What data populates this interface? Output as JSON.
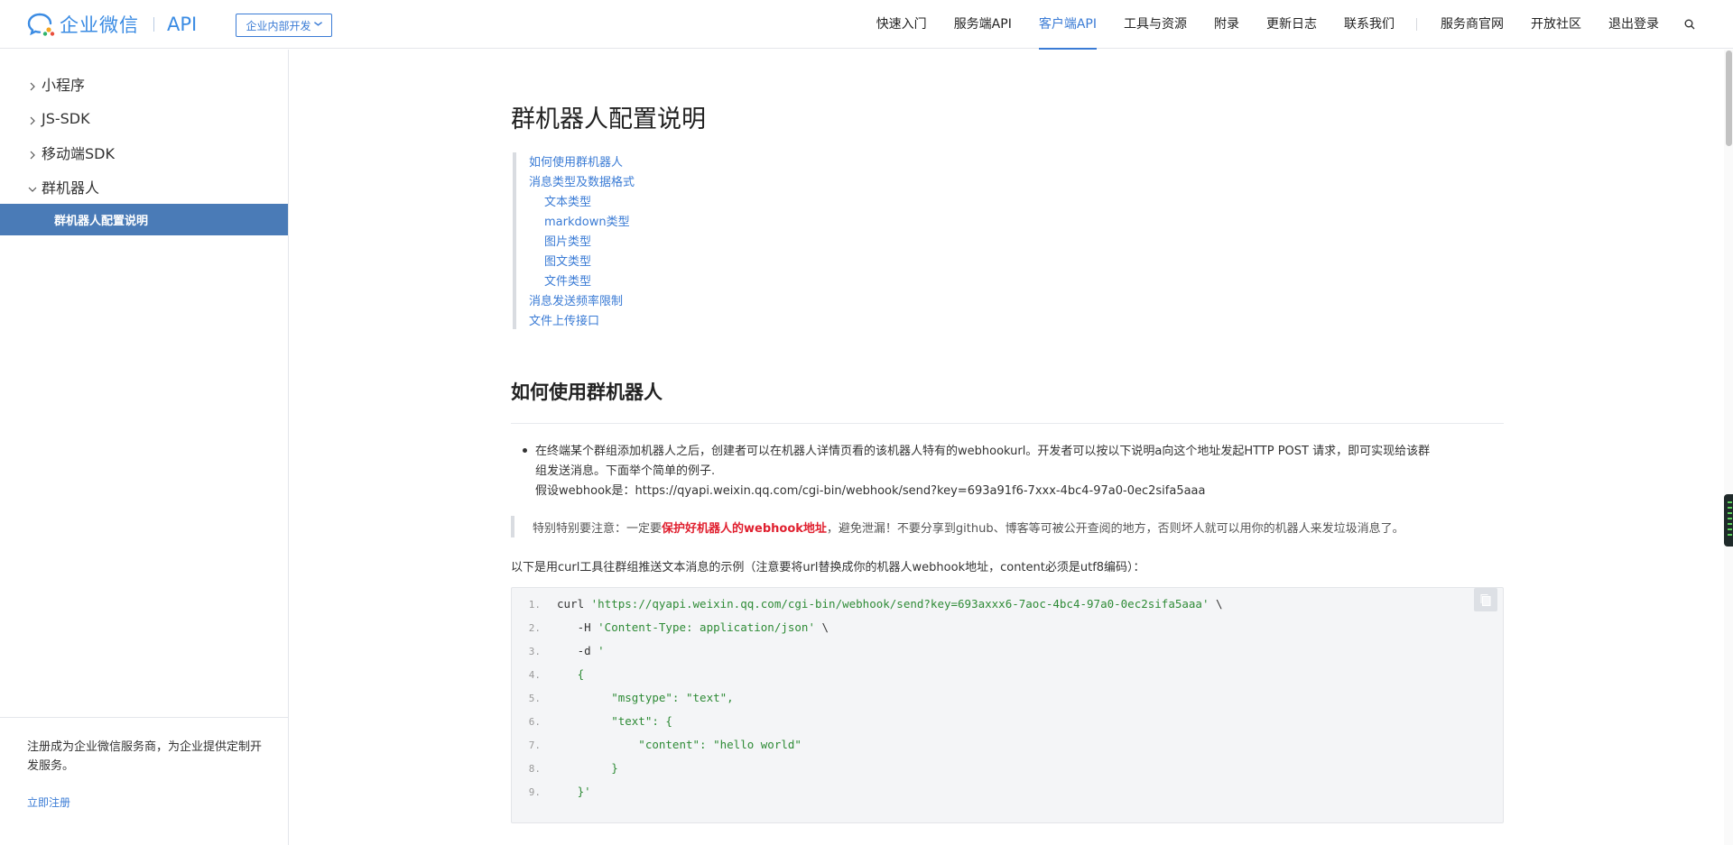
{
  "header": {
    "logo_text": "企业微信",
    "logo_api": "API",
    "dev_select": "企业内部开发",
    "nav": [
      {
        "label": "快速入门",
        "active": false
      },
      {
        "label": "服务端API",
        "active": false
      },
      {
        "label": "客户端API",
        "active": true
      },
      {
        "label": "工具与资源",
        "active": false
      },
      {
        "label": "附录",
        "active": false
      },
      {
        "label": "更新日志",
        "active": false
      },
      {
        "label": "联系我们",
        "active": false
      },
      {
        "label": "服务商官网",
        "active": false
      },
      {
        "label": "开放社区",
        "active": false
      },
      {
        "label": "退出登录",
        "active": false
      }
    ]
  },
  "sidebar": {
    "items": [
      {
        "label": "小程序",
        "expanded": false
      },
      {
        "label": "JS-SDK",
        "expanded": false
      },
      {
        "label": "移动端SDK",
        "expanded": false
      },
      {
        "label": "群机器人",
        "expanded": true
      }
    ],
    "active_sub": "群机器人配置说明",
    "footer_text": "注册成为企业微信服务商，为企业提供定制开发服务。",
    "register_link": "立即注册"
  },
  "content": {
    "title": "群机器人配置说明",
    "toc": [
      {
        "label": "如何使用群机器人",
        "level": 0
      },
      {
        "label": "消息类型及数据格式",
        "level": 0
      },
      {
        "label": "文本类型",
        "level": 1
      },
      {
        "label": "markdown类型",
        "level": 1
      },
      {
        "label": "图片类型",
        "level": 1
      },
      {
        "label": "图文类型",
        "level": 1
      },
      {
        "label": "文件类型",
        "level": 1
      },
      {
        "label": "消息发送频率限制",
        "level": 0
      },
      {
        "label": "文件上传接口",
        "level": 0
      }
    ],
    "section_title": "如何使用群机器人",
    "bullet_line1": "在终端某个群组添加机器人之后，创建者可以在机器人详情页看的该机器人特有的webhookurl。开发者可以按以下说明a向这个地址发起HTTP POST 请求，即可实现给该群",
    "bullet_line2": "组发送消息。下面举个简单的例子.",
    "bullet_line3": "假设webhook是：https://qyapi.weixin.qq.com/cgi-bin/webhook/send?key=693a91f6-7xxx-4bc4-97a0-0ec2sifa5aaa",
    "note_prefix": "特别特别要注意：一定要",
    "note_highlight": "保护好机器人的webhook地址",
    "note_suffix": "，避免泄漏！不要分享到github、博客等可被公开查阅的地方，否则坏人就可以用你的机器人来发垃圾消息了。",
    "intro": "以下是用curl工具往群组推送文本消息的示例（注意要将url替换成你的机器人webhook地址，content必须是utf8编码）：",
    "code_lines": [
      {
        "num": "1.",
        "pre": "curl ",
        "str": "'https://qyapi.weixin.qq.com/cgi-bin/webhook/send?key=693axxx6-7aoc-4bc4-97a0-0ec2sifa5aaa'",
        "post": " \\"
      },
      {
        "num": "2.",
        "pre": "   -H ",
        "str": "'Content-Type: application/json'",
        "post": " \\"
      },
      {
        "num": "3.",
        "pre": "   -d ",
        "str": "'",
        "post": ""
      },
      {
        "num": "4.",
        "pre": "",
        "str": "   {",
        "post": ""
      },
      {
        "num": "5.",
        "pre": "",
        "str": "        \"msgtype\": \"text\",",
        "post": ""
      },
      {
        "num": "6.",
        "pre": "",
        "str": "        \"text\": {",
        "post": ""
      },
      {
        "num": "7.",
        "pre": "",
        "str": "            \"content\": \"hello world\"",
        "post": ""
      },
      {
        "num": "8.",
        "pre": "",
        "str": "        }",
        "post": ""
      },
      {
        "num": "9.",
        "pre": "",
        "str": "   }'",
        "post": ""
      }
    ]
  },
  "colors": {
    "accent": "#3a7bd5",
    "sidebar_active": "#4a7bb7",
    "highlight": "#e0202f",
    "code_string": "#2e8b36"
  }
}
